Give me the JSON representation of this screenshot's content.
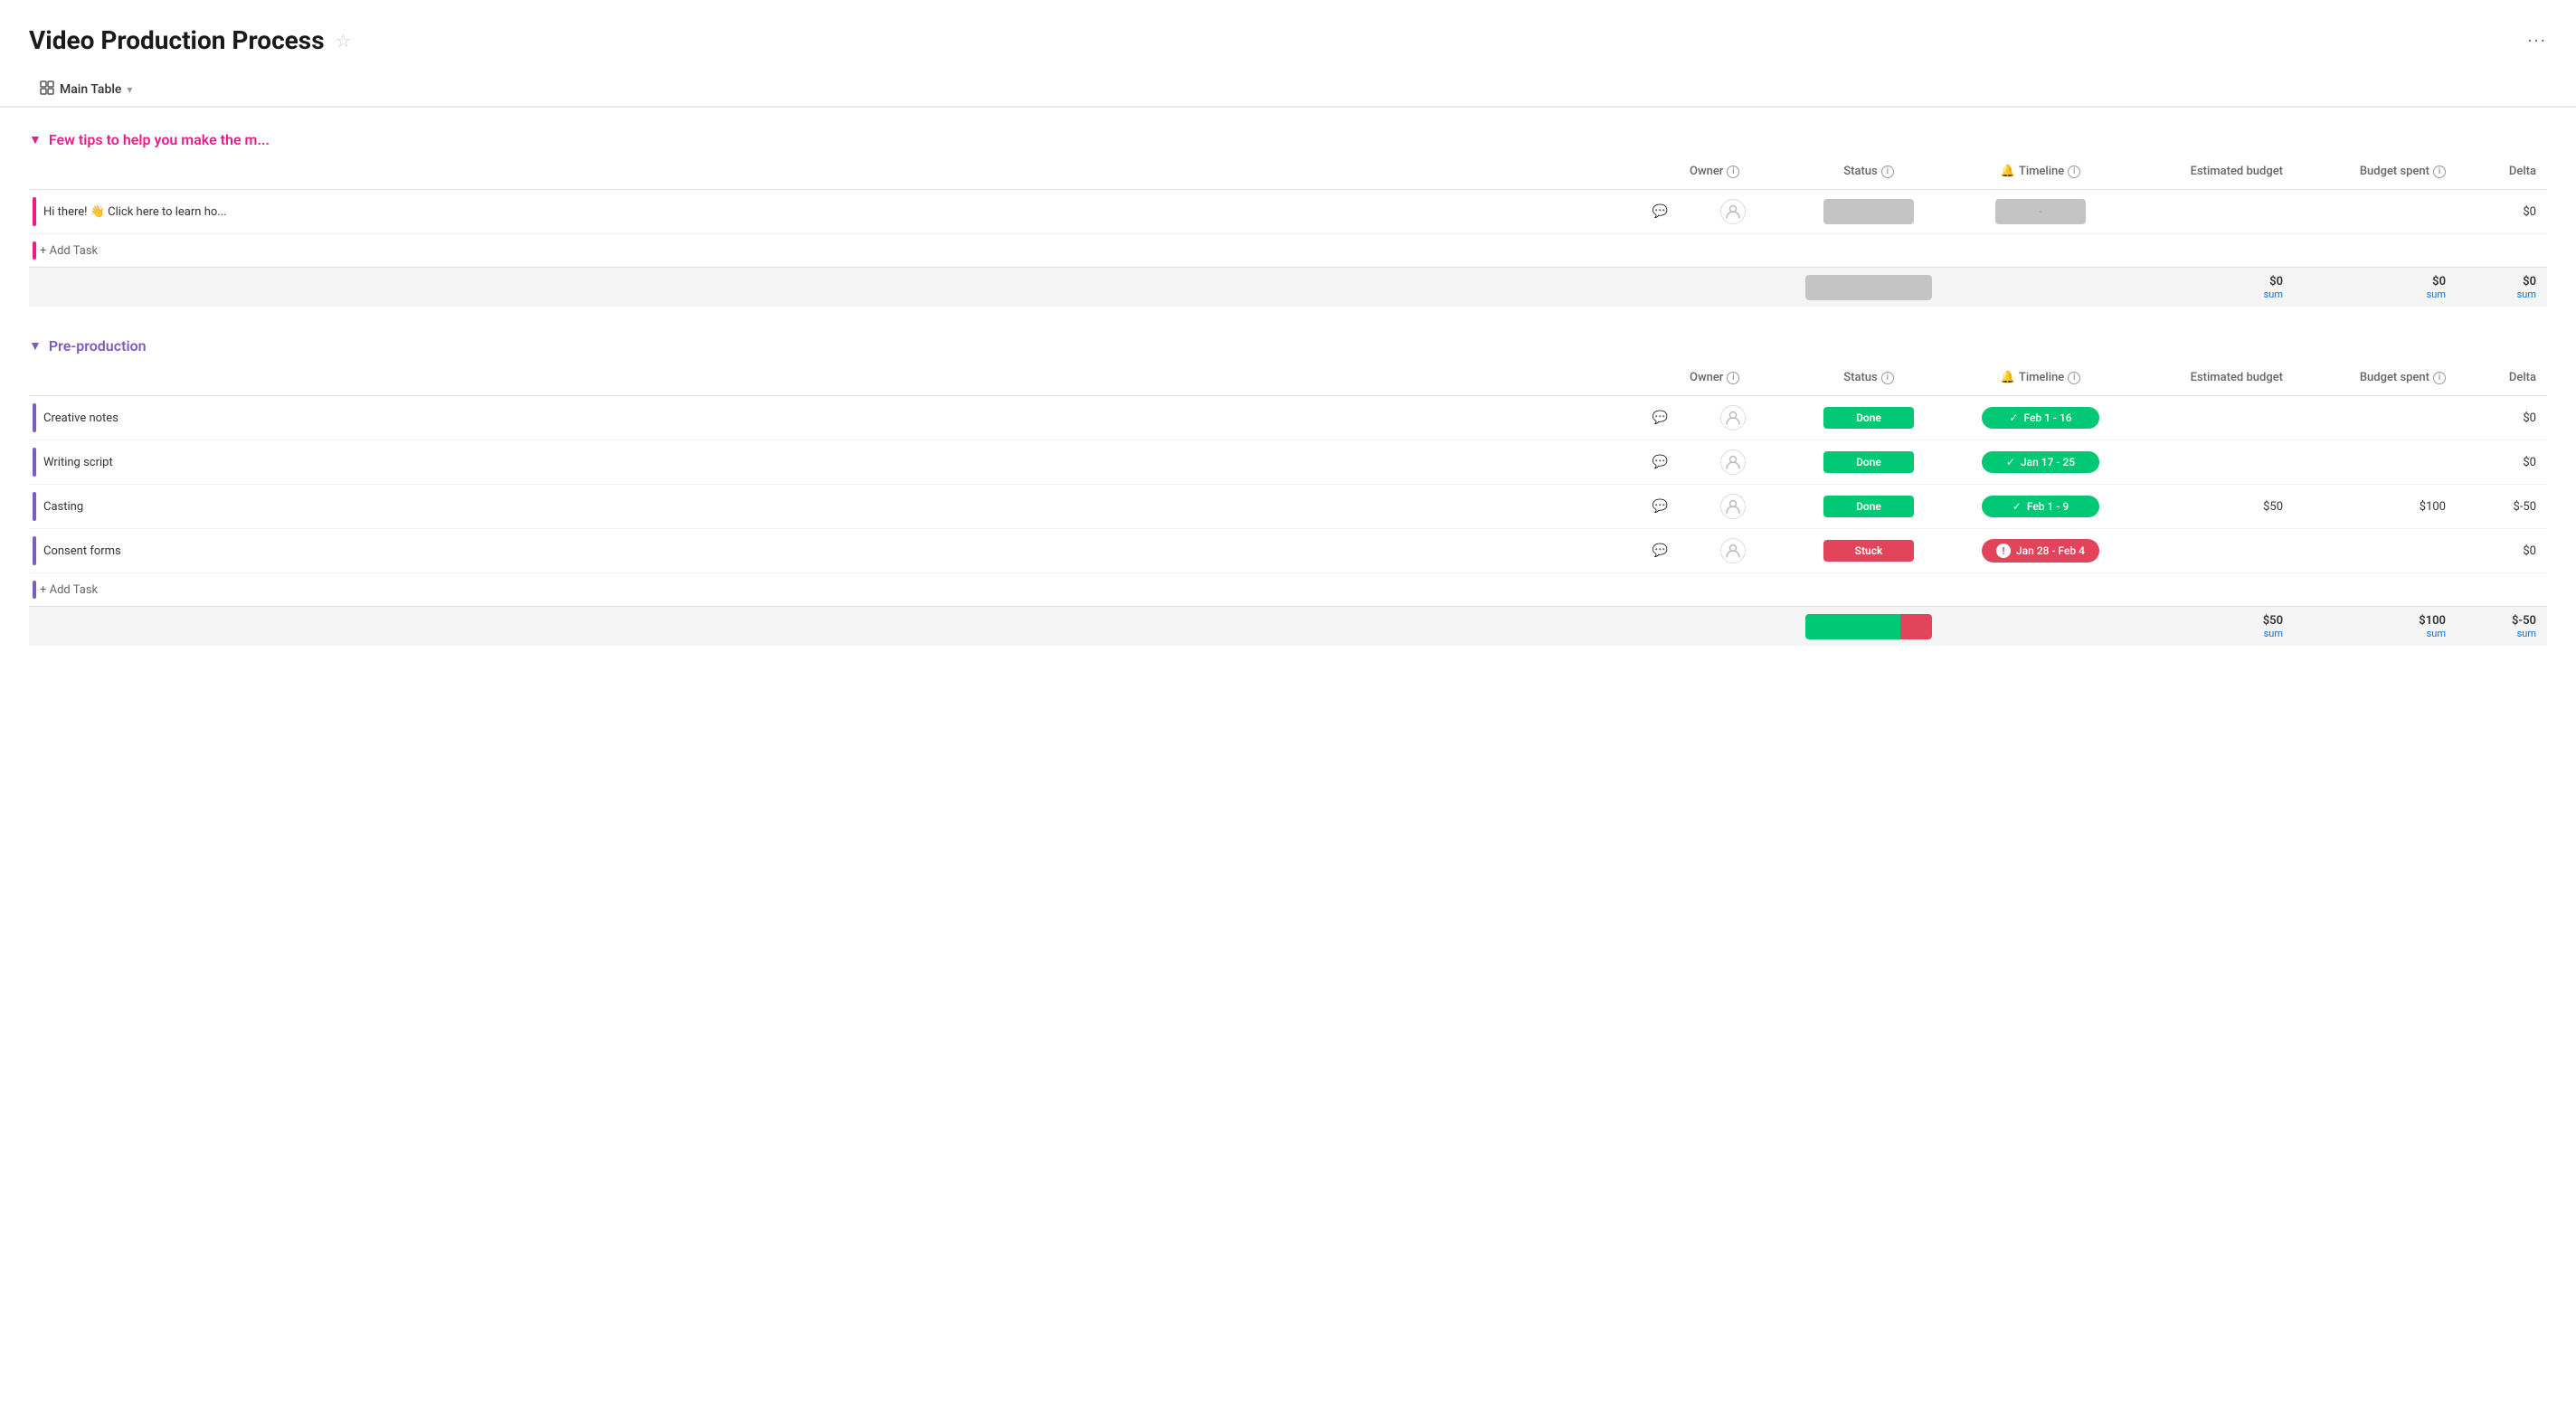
{
  "page": {
    "title": "Video Production Process",
    "more_label": "···"
  },
  "tab": {
    "label": "Main Table",
    "chevron": "▾"
  },
  "groups": [
    {
      "id": "tips",
      "name": "Few tips to help you make the m...",
      "color": "pink",
      "columns": {
        "task": "Few tips to help you make the m...",
        "owner": "Owner",
        "status": "Status",
        "timeline": "Timeline",
        "estimated_budget": "Estimated budget",
        "budget_spent": "Budget spent",
        "delta": "Delta"
      },
      "rows": [
        {
          "task": "Hi there! 👋 Click here to learn ho...",
          "owner": "",
          "status": "",
          "timeline": "-",
          "estimated_budget": "",
          "budget_spent": "",
          "delta": "$0"
        }
      ],
      "sum": {
        "status_bar": "gray",
        "estimated_budget": "$0",
        "budget_spent": "$0",
        "delta": "$0"
      }
    },
    {
      "id": "preproduction",
      "name": "Pre-production",
      "color": "purple",
      "columns": {
        "task": "Pre-production",
        "owner": "Owner",
        "status": "Status",
        "timeline": "Timeline",
        "estimated_budget": "Estimated budget",
        "budget_spent": "Budget spent",
        "delta": "Delta"
      },
      "rows": [
        {
          "task": "Creative notes",
          "owner": "",
          "status": "Done",
          "status_type": "done",
          "timeline": "Feb 1 - 16",
          "timeline_type": "green",
          "estimated_budget": "",
          "budget_spent": "",
          "delta": "$0"
        },
        {
          "task": "Writing script",
          "owner": "",
          "status": "Done",
          "status_type": "done",
          "timeline": "Jan 17 - 25",
          "timeline_type": "green",
          "estimated_budget": "",
          "budget_spent": "",
          "delta": "$0"
        },
        {
          "task": "Casting",
          "owner": "",
          "status": "Done",
          "status_type": "done",
          "timeline": "Feb 1 - 9",
          "timeline_type": "green",
          "estimated_budget": "$50",
          "budget_spent": "$100",
          "delta": "$-50"
        },
        {
          "task": "Consent forms",
          "owner": "",
          "status": "Stuck",
          "status_type": "stuck",
          "timeline": "Jan 28 - Feb 4",
          "timeline_type": "red",
          "estimated_budget": "",
          "budget_spent": "",
          "delta": "$0"
        }
      ],
      "sum": {
        "status_bar": "mixed",
        "green_pct": 75,
        "red_pct": 25,
        "estimated_budget": "$50",
        "budget_spent": "$100",
        "delta": "$-50"
      }
    }
  ],
  "add_task_label": "+ Add Task",
  "sum_label": "sum",
  "info_icon": "i",
  "star_icon": "☆",
  "bell_icon": "🔔"
}
